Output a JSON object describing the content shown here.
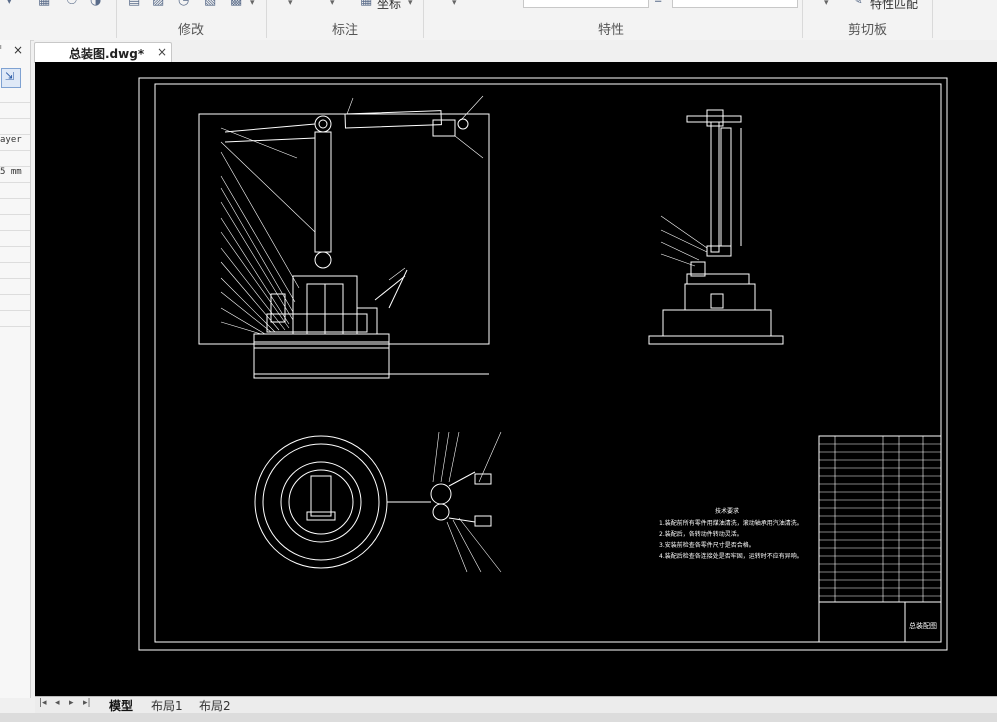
{
  "ribbon": {
    "groups": [
      {
        "label": "修改"
      },
      {
        "label": "标注"
      },
      {
        "label": "特性"
      },
      {
        "label": "剪切板"
      }
    ],
    "coord_label": "坐标",
    "match_label": "特性匹配"
  },
  "palette": {
    "rows": [
      "",
      "",
      "ayer",
      "",
      "5 mm",
      "",
      "",
      "",
      "",
      "",
      "",
      "",
      "",
      "",
      ""
    ]
  },
  "document": {
    "tab_title": "总装图.dwg*",
    "close_glyph": "×"
  },
  "layouts": {
    "tabs": [
      "模型",
      "布局1",
      "布局2"
    ],
    "active": 0
  },
  "drawing": {
    "notes_title": "技术要求",
    "notes": [
      "1.装配前所有零件用煤油清洗，滚动轴承用汽油清洗。",
      "2.装配后，各转动件转动灵活。",
      "3.安装前检查各零件尺寸是否合格。",
      "4.装配后检查各连接处是否牢固，运转时不应有异响。"
    ],
    "title_block_name": "总装配图"
  },
  "colors": {
    "canvas": "#000000",
    "line": "#ffffff"
  }
}
